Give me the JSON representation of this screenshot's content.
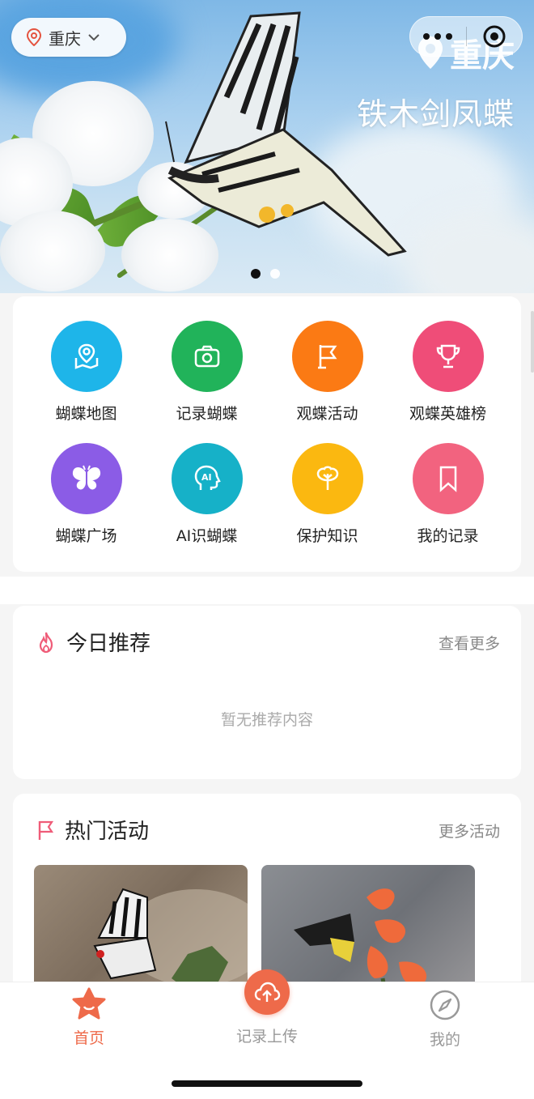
{
  "banner": {
    "location_pill": "重庆",
    "city_overlay": "重庆",
    "species_name": "铁木剑凤蝶",
    "page_count": 2,
    "active_page": 1
  },
  "grid": {
    "items": [
      {
        "label": "蝴蝶地图",
        "icon": "map-pin-icon",
        "color": "#1eb5e9"
      },
      {
        "label": "记录蝴蝶",
        "icon": "camera-icon",
        "color": "#21b35a"
      },
      {
        "label": "观蝶活动",
        "icon": "flag-icon",
        "color": "#fb7a14"
      },
      {
        "label": "观蝶英雄榜",
        "icon": "trophy-icon",
        "color": "#ef4d78"
      },
      {
        "label": "蝴蝶广场",
        "icon": "butterfly-icon",
        "color": "#8b5ce6"
      },
      {
        "label": "AI识蝴蝶",
        "icon": "ai-head-icon",
        "color": "#16b1c8"
      },
      {
        "label": "保护知识",
        "icon": "tree-icon",
        "color": "#fbb810"
      },
      {
        "label": "我的记录",
        "icon": "bookmark-icon",
        "color": "#f2637f"
      }
    ]
  },
  "recommend": {
    "title": "今日推荐",
    "more": "查看更多",
    "empty": "暂无推荐内容"
  },
  "activities": {
    "title": "热门活动",
    "more": "更多活动"
  },
  "tabbar": {
    "home": "首页",
    "upload": "记录上传",
    "mine": "我的"
  },
  "colors": {
    "accent": "#ee6a4a",
    "tab_inactive": "#999999"
  }
}
